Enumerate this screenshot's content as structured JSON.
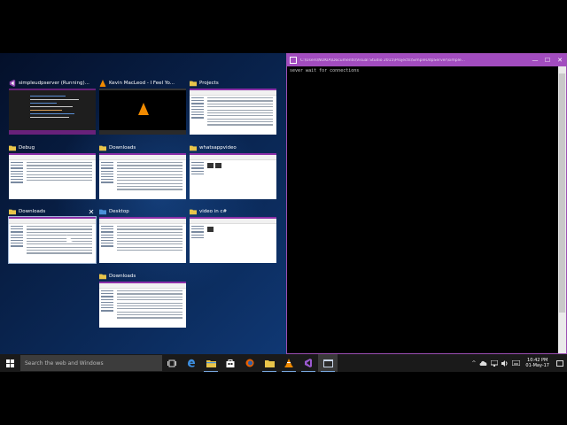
{
  "task_view": {
    "thumbnails": [
      {
        "title": "simpleudpserver (Running)...",
        "icon": "visual-studio-icon"
      },
      {
        "title": "Kevin MacLeod - I Feel Yo...",
        "icon": "vlc-icon"
      },
      {
        "title": "Projects",
        "icon": "folder-icon"
      },
      {
        "title": "Debug",
        "icon": "folder-icon"
      },
      {
        "title": "Downloads",
        "icon": "folder-icon"
      },
      {
        "title": "whatsappvideo",
        "icon": "folder-icon"
      },
      {
        "title": "Downloads",
        "icon": "folder-icon",
        "selected": true
      },
      {
        "title": "Desktop",
        "icon": "folder-icon"
      },
      {
        "title": "video in c#",
        "icon": "folder-icon"
      },
      {
        "title": "Downloads",
        "icon": "folder-icon"
      }
    ],
    "close_label": "✕"
  },
  "console": {
    "title": "C:\\Users\\NOKIA\\Documents\\Visual Studio 2015\\Projects\\SimpleUdpServer\\simple...",
    "output": "sever wait for connections",
    "minimize": "—",
    "maximize": "☐",
    "close": "✕"
  },
  "taskbar": {
    "search_placeholder": "Search the web and Windows",
    "pinned": [
      "task-view-icon",
      "edge-icon",
      "file-explorer-icon",
      "store-icon",
      "firefox-icon",
      "folder-icon",
      "vlc-icon",
      "visual-studio-icon",
      "console-icon"
    ],
    "time": "10:42 PM",
    "date": "01-May-17",
    "tray_chevron": "^"
  },
  "colors": {
    "console_title": "#a24cbf",
    "taskbar": "#1a1a1a",
    "accent": "#8b2fa8"
  }
}
